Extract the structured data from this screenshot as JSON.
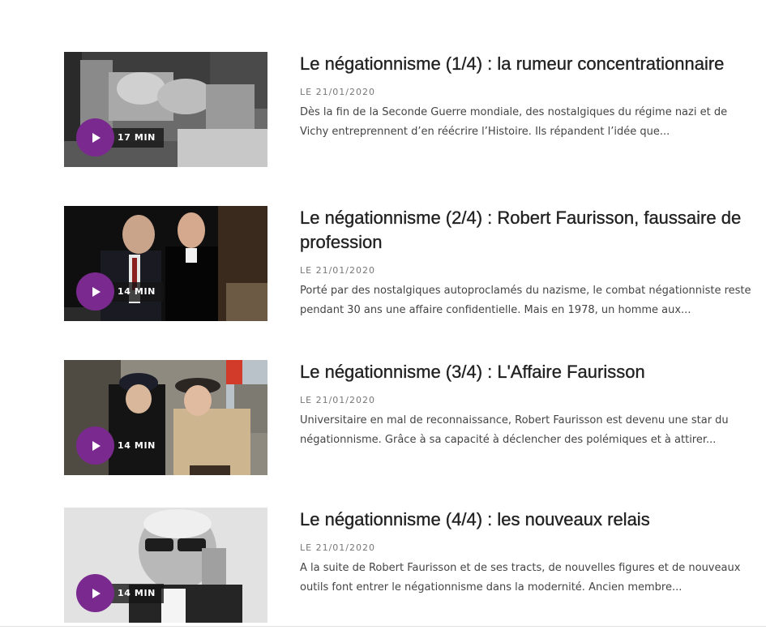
{
  "episodes": [
    {
      "title": "Le négationnisme (1/4) : la rumeur concentrationnaire",
      "date": "LE 21/01/2020",
      "description": "Dès la fin de la Seconde Guerre mondiale, des nostalgiques du régime nazi et de Vichy entreprennent d’en réécrire l’Histoire. Ils répandent l’idée que...",
      "duration": "17 MIN"
    },
    {
      "title": "Le négationnisme (2/4) : Robert Faurisson, faussaire de profession",
      "date": "LE 21/01/2020",
      "description": "Porté par des nostalgiques autoproclamés du nazisme, le combat négationniste reste pendant 30 ans une affaire confidentielle. Mais en 1978, un homme aux...",
      "duration": "14 MIN"
    },
    {
      "title": "Le négationnisme (3/4) : L'Affaire Faurisson",
      "date": "LE 21/01/2020",
      "description": "Universitaire en mal de reconnaissance, Robert Faurisson est devenu une star du négationnisme. Grâce à sa capacité à déclencher des polémiques et à attirer...",
      "duration": "14 MIN"
    },
    {
      "title": "Le négationnisme (4/4) : les nouveaux relais",
      "date": "LE 21/01/2020",
      "description": "A la suite de Robert Faurisson et de ses tracts, de nouvelles figures et de nouveaux outils font entrer le négationnisme dans la modernité. Ancien membre...",
      "duration": "14 MIN"
    }
  ],
  "icons": {
    "play": "play-icon"
  },
  "colors": {
    "play_button": "#7a2a8f",
    "title": "#222222",
    "date": "#777777",
    "description": "#444444"
  }
}
